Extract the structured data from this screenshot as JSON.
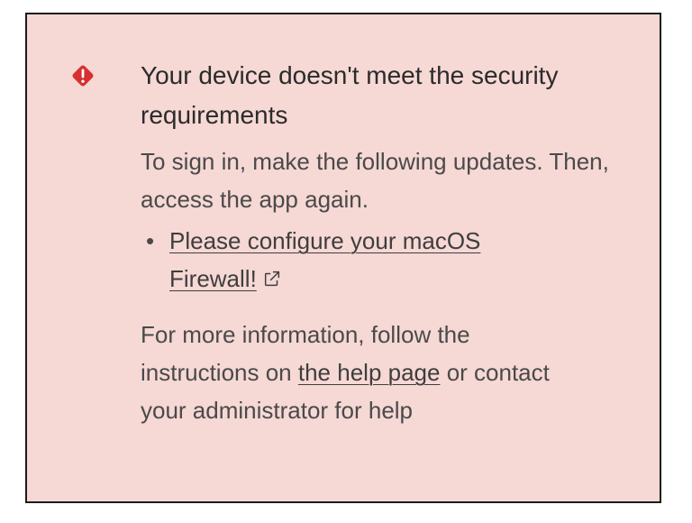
{
  "alert": {
    "icon": "alert-diamond-icon",
    "icon_color": "#d63031",
    "background": "#f6d8d4",
    "title": "Your device doesn't meet the security requirements",
    "intro": "To sign in, make the following updates. Then, access the app again.",
    "updates": [
      {
        "label": "Please configure your macOS Firewall!",
        "icon": "external-link-icon"
      }
    ],
    "more_info": {
      "before": "For more information, follow the instructions on ",
      "link": "the help page",
      "after": " or contact your administrator for help"
    }
  }
}
